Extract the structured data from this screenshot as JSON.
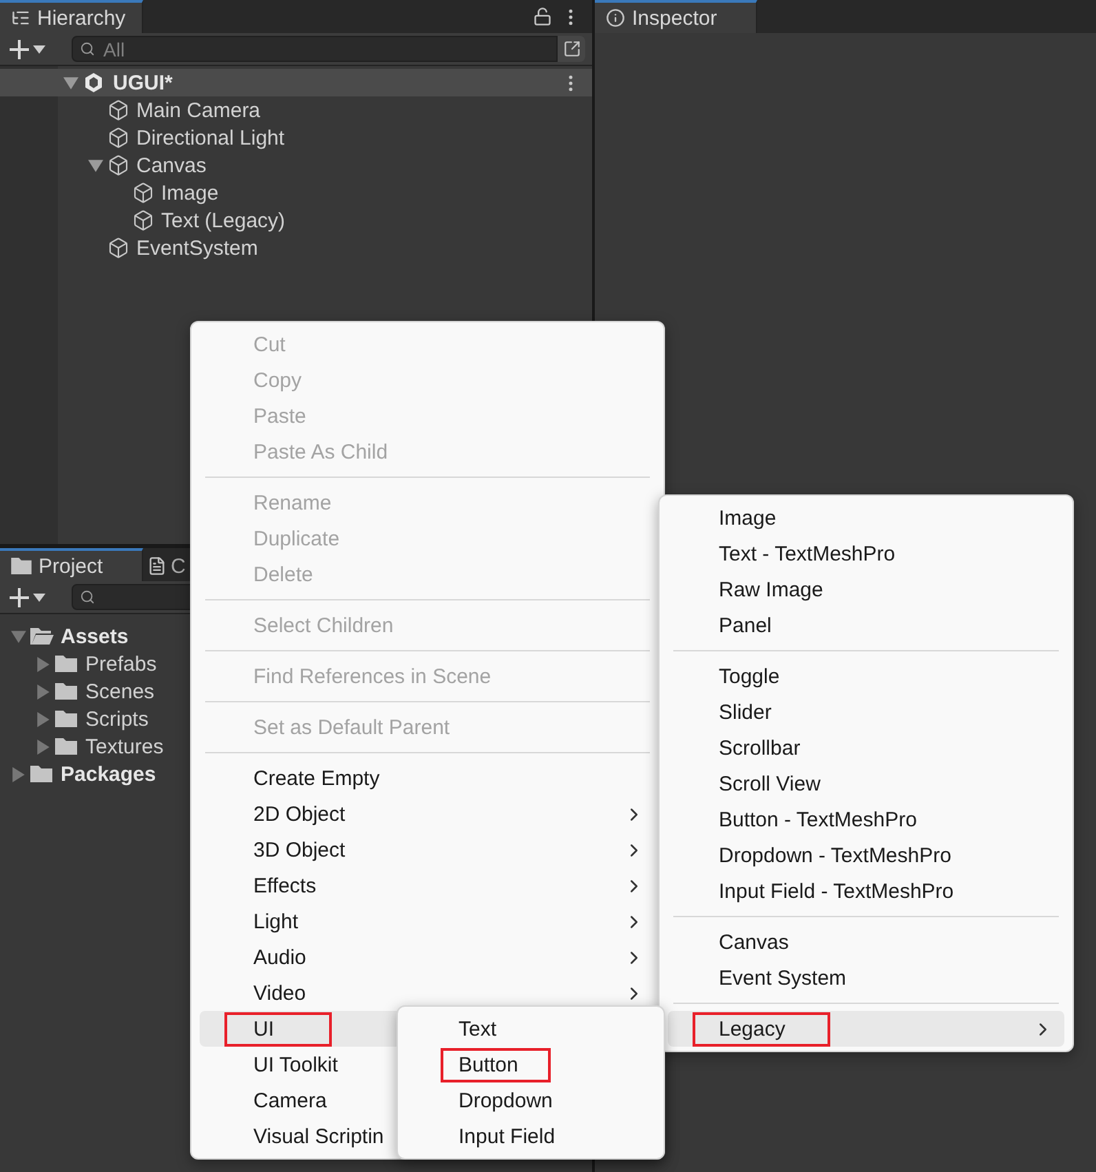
{
  "hierarchy": {
    "title": "Hierarchy",
    "search": {
      "placeholder": "All"
    },
    "scene": {
      "name": "UGUI*",
      "expanded": true,
      "children": [
        {
          "label": "Main Camera"
        },
        {
          "label": "Directional Light"
        },
        {
          "label": "Canvas",
          "expanded": true,
          "children": [
            {
              "label": "Image"
            },
            {
              "label": "Text (Legacy)"
            }
          ]
        },
        {
          "label": "EventSystem"
        }
      ]
    }
  },
  "inspector": {
    "title": "Inspector"
  },
  "project": {
    "tabs": [
      {
        "label": "Project",
        "selected": true,
        "kind": "folder"
      },
      {
        "label": "C",
        "selected": false,
        "kind": "console"
      }
    ],
    "tree": [
      {
        "label": "Assets",
        "expanded": true,
        "children": [
          {
            "label": "Prefabs",
            "expanded": false
          },
          {
            "label": "Scenes",
            "expanded": false
          },
          {
            "label": "Scripts",
            "expanded": false
          },
          {
            "label": "Textures",
            "expanded": false
          }
        ]
      },
      {
        "label": "Packages",
        "expanded": false
      }
    ]
  },
  "context_menu": {
    "groups": [
      [
        {
          "label": "Cut",
          "kind": "action",
          "disabled": true,
          "hovered": false,
          "highlighted": false
        },
        {
          "label": "Copy",
          "kind": "action",
          "disabled": true,
          "hovered": false,
          "highlighted": false
        },
        {
          "label": "Paste",
          "kind": "action",
          "disabled": true,
          "hovered": false,
          "highlighted": false
        },
        {
          "label": "Paste As Child",
          "kind": "action",
          "disabled": true,
          "hovered": false,
          "highlighted": false
        }
      ],
      [
        {
          "label": "Rename",
          "kind": "action",
          "disabled": true,
          "hovered": false,
          "highlighted": false
        },
        {
          "label": "Duplicate",
          "kind": "action",
          "disabled": true,
          "hovered": false,
          "highlighted": false
        },
        {
          "label": "Delete",
          "kind": "action",
          "disabled": true,
          "hovered": false,
          "highlighted": false
        }
      ],
      [
        {
          "label": "Select Children",
          "kind": "action",
          "disabled": true,
          "hovered": false,
          "highlighted": false
        }
      ],
      [
        {
          "label": "Find References in Scene",
          "kind": "action",
          "disabled": true,
          "hovered": false,
          "highlighted": false
        }
      ],
      [
        {
          "label": "Set as Default Parent",
          "kind": "action",
          "disabled": true,
          "hovered": false,
          "highlighted": false
        }
      ],
      [
        {
          "label": "Create Empty",
          "kind": "action",
          "disabled": false,
          "hovered": false,
          "highlighted": false
        },
        {
          "label": "2D Object",
          "kind": "submenu",
          "disabled": false,
          "hovered": false,
          "highlighted": false
        },
        {
          "label": "3D Object",
          "kind": "submenu",
          "disabled": false,
          "hovered": false,
          "highlighted": false
        },
        {
          "label": "Effects",
          "kind": "submenu",
          "disabled": false,
          "hovered": false,
          "highlighted": false
        },
        {
          "label": "Light",
          "kind": "submenu",
          "disabled": false,
          "hovered": false,
          "highlighted": false
        },
        {
          "label": "Audio",
          "kind": "submenu",
          "disabled": false,
          "hovered": false,
          "highlighted": false
        },
        {
          "label": "Video",
          "kind": "submenu",
          "disabled": false,
          "hovered": false,
          "highlighted": false
        },
        {
          "label": "UI",
          "kind": "action",
          "disabled": false,
          "hovered": true,
          "highlighted": true
        },
        {
          "label": "UI Toolkit",
          "kind": "action",
          "disabled": false,
          "hovered": false,
          "highlighted": false
        },
        {
          "label": "Camera",
          "kind": "action",
          "disabled": false,
          "hovered": false,
          "highlighted": false
        },
        {
          "label": "Visual Scriptin",
          "kind": "action",
          "disabled": false,
          "hovered": false,
          "highlighted": false
        }
      ]
    ]
  },
  "ui_submenu": {
    "groups": [
      [
        {
          "label": "Image",
          "kind": "action",
          "disabled": false,
          "hovered": false,
          "highlighted": false
        },
        {
          "label": "Text - TextMeshPro",
          "kind": "action",
          "disabled": false,
          "hovered": false,
          "highlighted": false
        },
        {
          "label": "Raw Image",
          "kind": "action",
          "disabled": false,
          "hovered": false,
          "highlighted": false
        },
        {
          "label": "Panel",
          "kind": "action",
          "disabled": false,
          "hovered": false,
          "highlighted": false
        }
      ],
      [
        {
          "label": "Toggle",
          "kind": "action",
          "disabled": false,
          "hovered": false,
          "highlighted": false
        },
        {
          "label": "Slider",
          "kind": "action",
          "disabled": false,
          "hovered": false,
          "highlighted": false
        },
        {
          "label": "Scrollbar",
          "kind": "action",
          "disabled": false,
          "hovered": false,
          "highlighted": false
        },
        {
          "label": "Scroll View",
          "kind": "action",
          "disabled": false,
          "hovered": false,
          "highlighted": false
        },
        {
          "label": "Button - TextMeshPro",
          "kind": "action",
          "disabled": false,
          "hovered": false,
          "highlighted": false
        },
        {
          "label": "Dropdown - TextMeshPro",
          "kind": "action",
          "disabled": false,
          "hovered": false,
          "highlighted": false
        },
        {
          "label": "Input Field - TextMeshPro",
          "kind": "action",
          "disabled": false,
          "hovered": false,
          "highlighted": false
        }
      ],
      [
        {
          "label": "Canvas",
          "kind": "action",
          "disabled": false,
          "hovered": false,
          "highlighted": false
        },
        {
          "label": "Event System",
          "kind": "action",
          "disabled": false,
          "hovered": false,
          "highlighted": false
        }
      ],
      [
        {
          "label": "Legacy",
          "kind": "submenu",
          "disabled": false,
          "hovered": true,
          "highlighted": true
        }
      ]
    ]
  },
  "legacy_submenu": {
    "groups": [
      [
        {
          "label": "Text",
          "disabled": false,
          "hovered": false,
          "highlighted": false
        },
        {
          "label": "Button",
          "disabled": false,
          "hovered": false,
          "highlighted": true
        },
        {
          "label": "Dropdown",
          "disabled": false,
          "hovered": false,
          "highlighted": false
        },
        {
          "label": "Input Field",
          "disabled": false,
          "hovered": false,
          "highlighted": false
        }
      ]
    ]
  }
}
